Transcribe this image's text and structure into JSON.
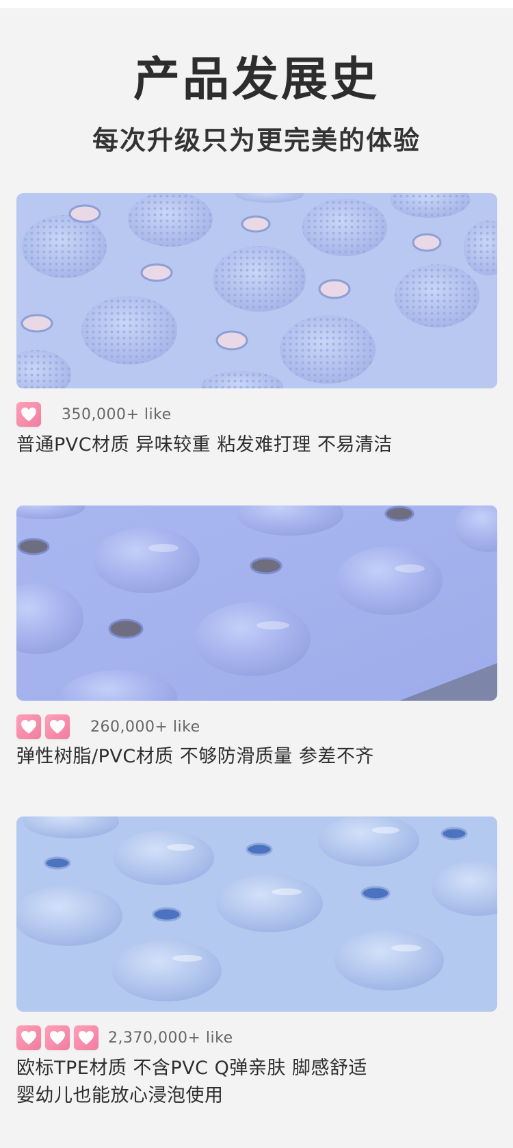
{
  "header": {
    "title": "产品发展史",
    "subtitle": "每次升级只为更完美的体验"
  },
  "products": [
    {
      "likes": "350,000+  like",
      "hearts": 1,
      "description_lines": [
        "普通PVC材质 异味较重 粘发难打理 不易清洁"
      ],
      "mat_color": "#b9c8f0"
    },
    {
      "likes": "260,000+  like",
      "hearts": 2,
      "description_lines": [
        "弹性树脂/PVC材质 不够防滑质量 参差不齐"
      ],
      "mat_color": "#a8b6ef"
    },
    {
      "likes": "2,370,000+  like",
      "hearts": 3,
      "description_lines": [
        "欧标TPE材质 不含PVC Q弹亲肤 脚感舒适",
        "婴幼儿也能放心浸泡使用"
      ],
      "mat_color": "#b3c9ef"
    }
  ],
  "icons": {
    "heart": "heart-icon"
  }
}
